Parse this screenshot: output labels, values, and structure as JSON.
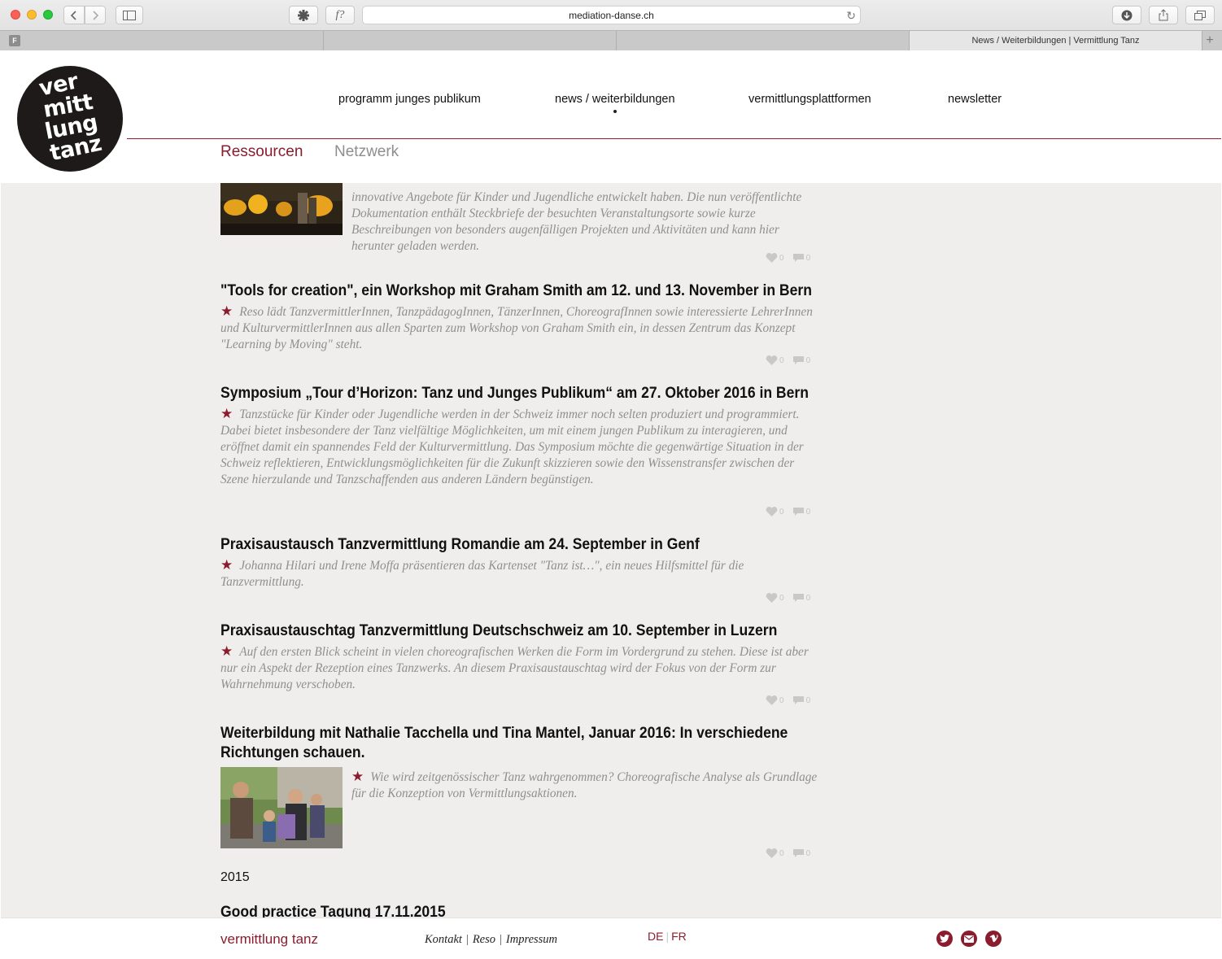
{
  "browser": {
    "url": "mediation-danse.ch",
    "active_tab_title": "News / Weiterbildungen | Vermittlung Tanz",
    "favicon_letter": "F",
    "font_button_label": "f?",
    "new_tab_label": "+"
  },
  "site": {
    "logo_lines": [
      "ver",
      "mitt",
      "lung",
      "tanz"
    ],
    "nav": [
      {
        "label": "programm junges publikum"
      },
      {
        "label": "news / weiterbildungen",
        "active": true
      },
      {
        "label": "vermittlungsplattformen"
      },
      {
        "label": "newsletter"
      }
    ],
    "subnav": {
      "ressourcen": "Ressourcen",
      "netzwerk": "Netzwerk"
    },
    "accent_color": "#8a1c2d"
  },
  "articles": [
    {
      "body": "innovative Angebote für Kinder und Jugendliche entwickelt haben. Die nun veröffentlichte Dokumentation enthält Steckbriefe der besuchten Veranstaltungsorte sowie kurze Beschreibungen von besonders augenfälligen Projekten und Aktivitäten und kann hier herunter geladen werden.",
      "likes": "0",
      "comments": "0"
    },
    {
      "title": "\"Tools for creation\", ein Workshop mit Graham Smith am 12. und 13. November in Bern",
      "body": "Reso lädt TanzvermittlerInnen, TanzpädagogInnen, TänzerInnen, ChoreografInnen sowie interessierte LehrerInnen und KulturvermittlerInnen aus allen Sparten zum Workshop von Graham Smith ein, in dessen Zentrum das Konzept \"Learning by Moving\" steht.",
      "likes": "0",
      "comments": "0"
    },
    {
      "title": "Symposium „Tour d’Horizon: Tanz und Junges Publikum“ am 27. Oktober 2016 in Bern",
      "body": "Tanzstücke für Kinder oder Jugendliche werden in der Schweiz immer noch selten produziert und programmiert. Dabei bietet insbesondere der Tanz vielfältige Möglichkeiten, um mit einem jungen Publikum zu interagieren, und eröffnet damit ein spannendes Feld der Kulturvermittlung. Das Symposium möchte die gegenwärtige Situation in der Schweiz reflektieren, Entwicklungsmöglichkeiten für die Zukunft skizzieren sowie den Wissenstransfer zwischen der Szene hierzulande und Tanzschaffenden aus anderen Ländern begünstigen.",
      "likes": "0",
      "comments": "0"
    },
    {
      "title": "Praxisaustausch Tanzvermittlung Romandie am 24. September in Genf",
      "body": "Johanna Hilari und Irene Moffa präsentieren das Kartenset \"Tanz ist…\", ein neues Hilfsmittel für die Tanzvermittlung.",
      "likes": "0",
      "comments": "0"
    },
    {
      "title": "Praxisaustauschtag Tanzvermittlung Deutschschweiz am 10. September in Luzern",
      "body": "Auf den ersten Blick scheint in vielen choreografischen Werken die Form im Vordergrund zu stehen. Diese ist aber nur ein Aspekt der Rezeption eines Tanzwerks. An diesem Praxisaustauschtag wird der Fokus von der Form zur Wahrnehmung verschoben.",
      "likes": "0",
      "comments": "0"
    },
    {
      "title": "Weiterbildung mit Nathalie Tacchella und Tina Mantel, Januar 2016: In verschiedene Richtungen schauen.",
      "body": "Wie wird zeitgenössischer Tanz wahrgenommen? Choreografische Analyse als Grundlage für die Konzeption von Vermittlungsaktionen.",
      "likes": "0",
      "comments": "0"
    }
  ],
  "year_heading": "2015",
  "next_title": "Good practice Tagung 17.11.2015",
  "footer": {
    "brand": "vermittlung tanz",
    "links": [
      "Kontakt",
      "Reso",
      "Impressum"
    ],
    "lang_de": "DE",
    "lang_fr": "FR",
    "social_icons": [
      "twitter-icon",
      "mail-icon",
      "vimeo-icon"
    ]
  }
}
